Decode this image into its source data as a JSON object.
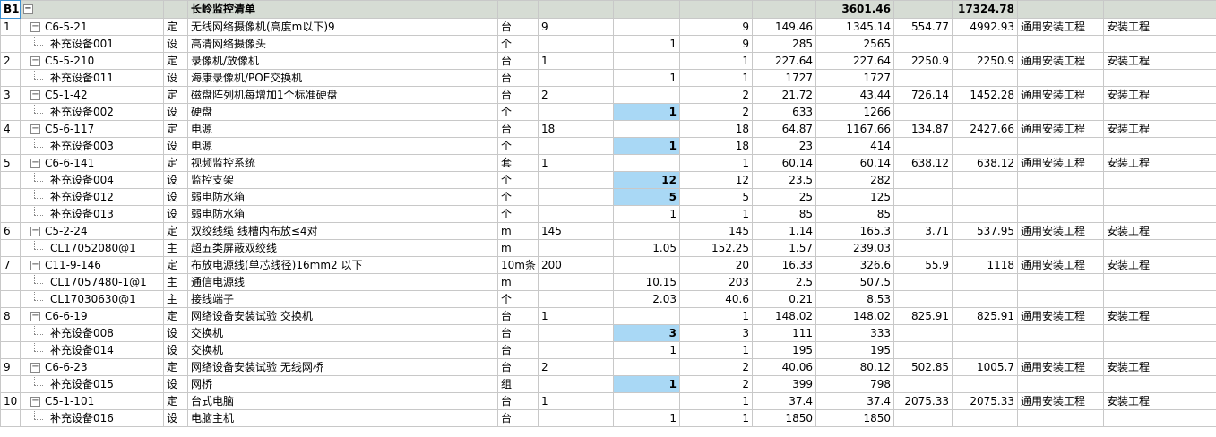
{
  "header": {
    "id": "B1",
    "name": "长岭监控清单",
    "total_amount": "3601.46",
    "total2": "17324.78"
  },
  "rows": [
    {
      "type": "main",
      "num": "1",
      "code": "C6-5-21",
      "cat": "定",
      "name": "无线网络摄像机(高度m以下)9",
      "unit": "台",
      "qty": "9",
      "contrib": "",
      "cnt": "9",
      "price": "149.46",
      "amt": "1345.14",
      "c11": "554.77",
      "c12": "4992.93",
      "c13": "通用安装工程",
      "c14": "安装工程"
    },
    {
      "type": "sub",
      "num": "",
      "code": "补充设备001",
      "cat": "设",
      "name": "高清网络摄像头",
      "unit": "个",
      "qty": "",
      "contrib": "1",
      "cnt": "9",
      "price": "285",
      "amt": "2565",
      "c11": "",
      "c12": "",
      "c13": "",
      "c14": "",
      "sel": false
    },
    {
      "type": "main",
      "num": "2",
      "code": "C5-5-210",
      "cat": "定",
      "name": "录像机/放像机",
      "unit": "台",
      "qty": "1",
      "contrib": "",
      "cnt": "1",
      "price": "227.64",
      "amt": "227.64",
      "c11": "2250.9",
      "c12": "2250.9",
      "c13": "通用安装工程",
      "c14": "安装工程"
    },
    {
      "type": "sub",
      "num": "",
      "code": "补充设备011",
      "cat": "设",
      "name": "海康录像机/POE交换机",
      "unit": "台",
      "qty": "",
      "contrib": "1",
      "cnt": "1",
      "price": "1727",
      "amt": "1727",
      "c11": "",
      "c12": "",
      "c13": "",
      "c14": "",
      "sel": false
    },
    {
      "type": "main",
      "num": "3",
      "code": "C5-1-42",
      "cat": "定",
      "name": "磁盘阵列机每增加1个标准硬盘",
      "unit": "台",
      "qty": "2",
      "contrib": "",
      "cnt": "2",
      "price": "21.72",
      "amt": "43.44",
      "c11": "726.14",
      "c12": "1452.28",
      "c13": "通用安装工程",
      "c14": "安装工程"
    },
    {
      "type": "sub",
      "num": "",
      "code": "补充设备002",
      "cat": "设",
      "name": "硬盘",
      "unit": "个",
      "qty": "",
      "contrib": "1",
      "cnt": "2",
      "price": "633",
      "amt": "1266",
      "c11": "",
      "c12": "",
      "c13": "",
      "c14": "",
      "sel": true
    },
    {
      "type": "main",
      "num": "4",
      "code": "C5-6-117",
      "cat": "定",
      "name": "电源",
      "unit": "台",
      "qty": "18",
      "contrib": "",
      "cnt": "18",
      "price": "64.87",
      "amt": "1167.66",
      "c11": "134.87",
      "c12": "2427.66",
      "c13": "通用安装工程",
      "c14": "安装工程"
    },
    {
      "type": "sub",
      "num": "",
      "code": "补充设备003",
      "cat": "设",
      "name": "电源",
      "unit": "个",
      "qty": "",
      "contrib": "1",
      "cnt": "18",
      "price": "23",
      "amt": "414",
      "c11": "",
      "c12": "",
      "c13": "",
      "c14": "",
      "sel": true
    },
    {
      "type": "main",
      "num": "5",
      "code": "C6-6-141",
      "cat": "定",
      "name": "视频监控系统",
      "unit": "套",
      "qty": "1",
      "contrib": "",
      "cnt": "1",
      "price": "60.14",
      "amt": "60.14",
      "c11": "638.12",
      "c12": "638.12",
      "c13": "通用安装工程",
      "c14": "安装工程"
    },
    {
      "type": "sub",
      "num": "",
      "code": "补充设备004",
      "cat": "设",
      "name": "监控支架",
      "unit": "个",
      "qty": "",
      "contrib": "12",
      "cnt": "12",
      "price": "23.5",
      "amt": "282",
      "c11": "",
      "c12": "",
      "c13": "",
      "c14": "",
      "sel": true
    },
    {
      "type": "sub",
      "num": "",
      "code": "补充设备012",
      "cat": "设",
      "name": "弱电防水箱",
      "unit": "个",
      "qty": "",
      "contrib": "5",
      "cnt": "5",
      "price": "25",
      "amt": "125",
      "c11": "",
      "c12": "",
      "c13": "",
      "c14": "",
      "sel": true
    },
    {
      "type": "sub",
      "num": "",
      "code": "补充设备013",
      "cat": "设",
      "name": "弱电防水箱",
      "unit": "个",
      "qty": "",
      "contrib": "1",
      "cnt": "1",
      "price": "85",
      "amt": "85",
      "c11": "",
      "c12": "",
      "c13": "",
      "c14": "",
      "sel": false
    },
    {
      "type": "main",
      "num": "6",
      "code": "C5-2-24",
      "cat": "定",
      "name": "双绞线缆 线槽内布放≤4对",
      "unit": "m",
      "qty": "145",
      "contrib": "",
      "cnt": "145",
      "price": "1.14",
      "amt": "165.3",
      "c11": "3.71",
      "c12": "537.95",
      "c13": "通用安装工程",
      "c14": "安装工程"
    },
    {
      "type": "sub",
      "num": "",
      "code": "CL17052080@1",
      "cat": "主",
      "name": "超五类屏蔽双绞线",
      "unit": "m",
      "qty": "",
      "contrib": "1.05",
      "cnt": "152.25",
      "price": "1.57",
      "amt": "239.03",
      "c11": "",
      "c12": "",
      "c13": "",
      "c14": "",
      "sel": false
    },
    {
      "type": "main",
      "num": "7",
      "code": "C11-9-146",
      "cat": "定",
      "name": "布放电源线(单芯线径)16mm2 以下",
      "unit": "10m条",
      "qty": "200",
      "contrib": "",
      "cnt": "20",
      "price": "16.33",
      "amt": "326.6",
      "c11": "55.9",
      "c12": "1118",
      "c13": "通用安装工程",
      "c14": "安装工程"
    },
    {
      "type": "sub",
      "num": "",
      "code": "CL17057480-1@1",
      "cat": "主",
      "name": "通信电源线",
      "unit": "m",
      "qty": "",
      "contrib": "10.15",
      "cnt": "203",
      "price": "2.5",
      "amt": "507.5",
      "c11": "",
      "c12": "",
      "c13": "",
      "c14": "",
      "sel": false
    },
    {
      "type": "sub",
      "num": "",
      "code": "CL17030630@1",
      "cat": "主",
      "name": "接线端子",
      "unit": "个",
      "qty": "",
      "contrib": "2.03",
      "cnt": "40.6",
      "price": "0.21",
      "amt": "8.53",
      "c11": "",
      "c12": "",
      "c13": "",
      "c14": "",
      "sel": false
    },
    {
      "type": "main",
      "num": "8",
      "code": "C6-6-19",
      "cat": "定",
      "name": "网络设备安装试验 交换机",
      "unit": "台",
      "qty": "1",
      "contrib": "",
      "cnt": "1",
      "price": "148.02",
      "amt": "148.02",
      "c11": "825.91",
      "c12": "825.91",
      "c13": "通用安装工程",
      "c14": "安装工程"
    },
    {
      "type": "sub",
      "num": "",
      "code": "补充设备008",
      "cat": "设",
      "name": "交换机",
      "unit": "台",
      "qty": "",
      "contrib": "3",
      "cnt": "3",
      "price": "111",
      "amt": "333",
      "c11": "",
      "c12": "",
      "c13": "",
      "c14": "",
      "sel": true
    },
    {
      "type": "sub",
      "num": "",
      "code": "补充设备014",
      "cat": "设",
      "name": "交换机",
      "unit": "台",
      "qty": "",
      "contrib": "1",
      "cnt": "1",
      "price": "195",
      "amt": "195",
      "c11": "",
      "c12": "",
      "c13": "",
      "c14": "",
      "sel": false
    },
    {
      "type": "main",
      "num": "9",
      "code": "C6-6-23",
      "cat": "定",
      "name": "网络设备安装试验 无线网桥",
      "unit": "台",
      "qty": "2",
      "contrib": "",
      "cnt": "2",
      "price": "40.06",
      "amt": "80.12",
      "c11": "502.85",
      "c12": "1005.7",
      "c13": "通用安装工程",
      "c14": "安装工程"
    },
    {
      "type": "sub",
      "num": "",
      "code": "补充设备015",
      "cat": "设",
      "name": "网桥",
      "unit": "组",
      "qty": "",
      "contrib": "1",
      "cnt": "2",
      "price": "399",
      "amt": "798",
      "c11": "",
      "c12": "",
      "c13": "",
      "c14": "",
      "sel": true
    },
    {
      "type": "main",
      "num": "10",
      "code": "C5-1-101",
      "cat": "定",
      "name": "台式电脑",
      "unit": "台",
      "qty": "1",
      "contrib": "",
      "cnt": "1",
      "price": "37.4",
      "amt": "37.4",
      "c11": "2075.33",
      "c12": "2075.33",
      "c13": "通用安装工程",
      "c14": "安装工程"
    },
    {
      "type": "sub",
      "num": "",
      "code": "补充设备016",
      "cat": "设",
      "name": "电脑主机",
      "unit": "台",
      "qty": "",
      "contrib": "1",
      "cnt": "1",
      "price": "1850",
      "amt": "1850",
      "c11": "",
      "c12": "",
      "c13": "",
      "c14": "",
      "sel": false
    }
  ]
}
